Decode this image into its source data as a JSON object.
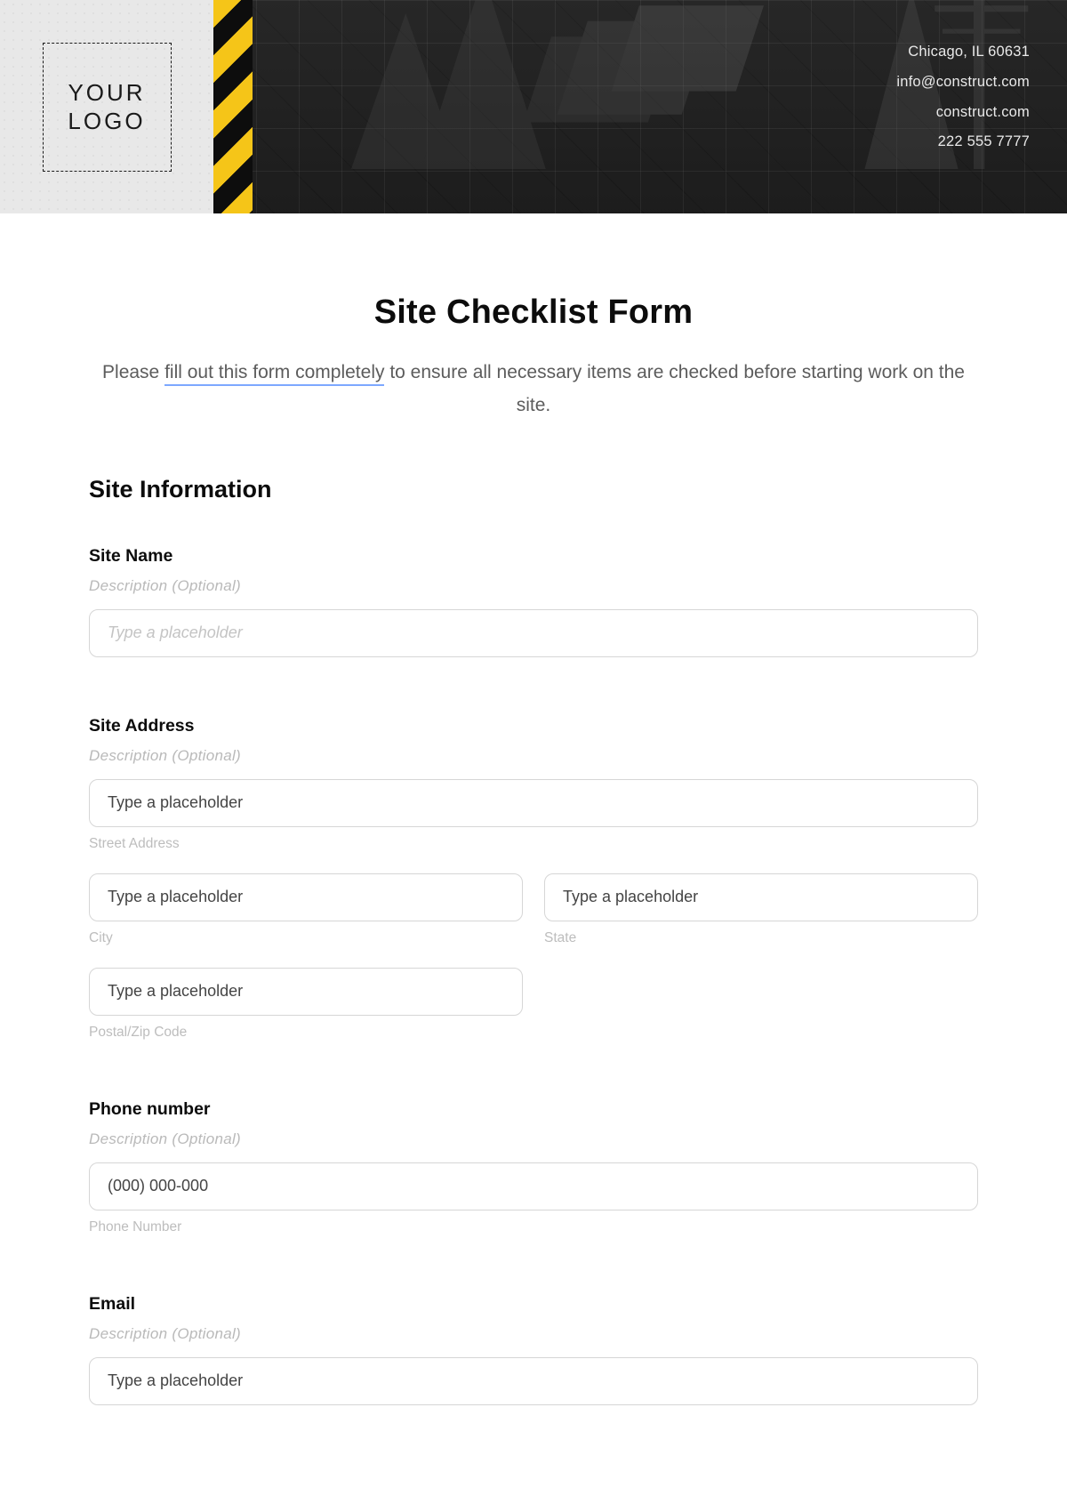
{
  "header": {
    "logo_text": "YOUR LOGO",
    "contact": {
      "line1": "Chicago, IL 60631",
      "line2": "info@construct.com",
      "line3": "construct.com",
      "line4": "222 555 7777"
    }
  },
  "form": {
    "title": "Site Checklist Form",
    "lead_prefix": "Please ",
    "lead_underlined": "fill out this form completely",
    "lead_suffix": " to ensure all necessary items are checked before starting work on the site.",
    "section1_heading": "Site Information",
    "desc_optional": "Description (Optional)",
    "placeholder_generic": "Type a placeholder",
    "site_name": {
      "label": "Site Name"
    },
    "site_address": {
      "label": "Site Address",
      "street_sub": "Street Address",
      "city_sub": "City",
      "state_sub": "State",
      "zip_sub": "Postal/Zip Code"
    },
    "phone": {
      "label": "Phone number",
      "placeholder": "(000) 000-000",
      "sub": "Phone Number"
    },
    "email": {
      "label": "Email"
    }
  }
}
